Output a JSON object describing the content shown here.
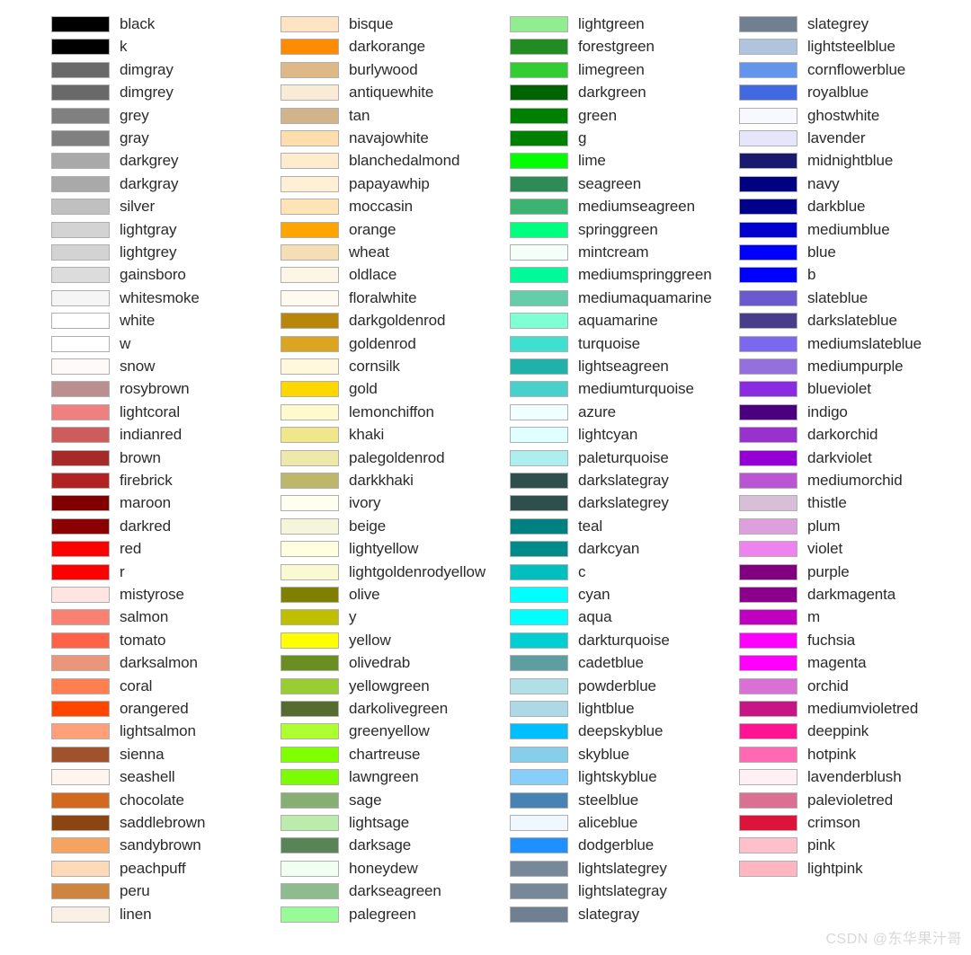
{
  "chart_data": {
    "type": "table",
    "title": "",
    "subtitle": "",
    "xlabel": "",
    "ylabel": "",
    "layout": {
      "columns": 4,
      "rows_per_column": 40,
      "swatch_border": "#b0b0b0",
      "background": "#ffffff",
      "text_color": "#2b2b2b"
    },
    "columns": [
      {
        "index": 0,
        "entries": [
          {
            "label": "black",
            "hex": "#000000"
          },
          {
            "label": "k",
            "hex": "#000000"
          },
          {
            "label": "dimgray",
            "hex": "#696969"
          },
          {
            "label": "dimgrey",
            "hex": "#696969"
          },
          {
            "label": "grey",
            "hex": "#808080"
          },
          {
            "label": "gray",
            "hex": "#808080"
          },
          {
            "label": "darkgrey",
            "hex": "#a9a9a9"
          },
          {
            "label": "darkgray",
            "hex": "#a9a9a9"
          },
          {
            "label": "silver",
            "hex": "#c0c0c0"
          },
          {
            "label": "lightgray",
            "hex": "#d3d3d3"
          },
          {
            "label": "lightgrey",
            "hex": "#d3d3d3"
          },
          {
            "label": "gainsboro",
            "hex": "#dcdcdc"
          },
          {
            "label": "whitesmoke",
            "hex": "#f5f5f5"
          },
          {
            "label": "white",
            "hex": "#ffffff"
          },
          {
            "label": "w",
            "hex": "#ffffff"
          },
          {
            "label": "snow",
            "hex": "#fffafa"
          },
          {
            "label": "rosybrown",
            "hex": "#bc8f8f"
          },
          {
            "label": "lightcoral",
            "hex": "#f08080"
          },
          {
            "label": "indianred",
            "hex": "#cd5c5c"
          },
          {
            "label": "brown",
            "hex": "#a52a2a"
          },
          {
            "label": "firebrick",
            "hex": "#b22222"
          },
          {
            "label": "maroon",
            "hex": "#800000"
          },
          {
            "label": "darkred",
            "hex": "#8b0000"
          },
          {
            "label": "red",
            "hex": "#ff0000"
          },
          {
            "label": "r",
            "hex": "#ff0000"
          },
          {
            "label": "mistyrose",
            "hex": "#ffe4e1"
          },
          {
            "label": "salmon",
            "hex": "#fa8072"
          },
          {
            "label": "tomato",
            "hex": "#ff6347"
          },
          {
            "label": "darksalmon",
            "hex": "#e9967a"
          },
          {
            "label": "coral",
            "hex": "#ff7f50"
          },
          {
            "label": "orangered",
            "hex": "#ff4500"
          },
          {
            "label": "lightsalmon",
            "hex": "#ffa07a"
          },
          {
            "label": "sienna",
            "hex": "#a0522d"
          },
          {
            "label": "seashell",
            "hex": "#fff5ee"
          },
          {
            "label": "chocolate",
            "hex": "#d2691e"
          },
          {
            "label": "saddlebrown",
            "hex": "#8b4513"
          },
          {
            "label": "sandybrown",
            "hex": "#f4a460"
          },
          {
            "label": "peachpuff",
            "hex": "#ffdab9"
          },
          {
            "label": "peru",
            "hex": "#cd853f"
          },
          {
            "label": "linen",
            "hex": "#faf0e6"
          }
        ]
      },
      {
        "index": 1,
        "entries": [
          {
            "label": "bisque",
            "hex": "#ffe4c4"
          },
          {
            "label": "darkorange",
            "hex": "#ff8c00"
          },
          {
            "label": "burlywood",
            "hex": "#deb887"
          },
          {
            "label": "antiquewhite",
            "hex": "#faebd7"
          },
          {
            "label": "tan",
            "hex": "#d2b48c"
          },
          {
            "label": "navajowhite",
            "hex": "#ffdead"
          },
          {
            "label": "blanchedalmond",
            "hex": "#ffebcd"
          },
          {
            "label": "papayawhip",
            "hex": "#ffefd5"
          },
          {
            "label": "moccasin",
            "hex": "#ffe4b5"
          },
          {
            "label": "orange",
            "hex": "#ffa500"
          },
          {
            "label": "wheat",
            "hex": "#f5deb3"
          },
          {
            "label": "oldlace",
            "hex": "#fdf5e6"
          },
          {
            "label": "floralwhite",
            "hex": "#fffaf0"
          },
          {
            "label": "darkgoldenrod",
            "hex": "#b8860b"
          },
          {
            "label": "goldenrod",
            "hex": "#daa520"
          },
          {
            "label": "cornsilk",
            "hex": "#fff8dc"
          },
          {
            "label": "gold",
            "hex": "#ffd700"
          },
          {
            "label": "lemonchiffon",
            "hex": "#fffacd"
          },
          {
            "label": "khaki",
            "hex": "#f0e68c"
          },
          {
            "label": "palegoldenrod",
            "hex": "#eee8aa"
          },
          {
            "label": "darkkhaki",
            "hex": "#bdb76b"
          },
          {
            "label": "ivory",
            "hex": "#fffff0"
          },
          {
            "label": "beige",
            "hex": "#f5f5dc"
          },
          {
            "label": "lightyellow",
            "hex": "#ffffe0"
          },
          {
            "label": "lightgoldenrodyellow",
            "hex": "#fafad2"
          },
          {
            "label": "olive",
            "hex": "#808000"
          },
          {
            "label": "y",
            "hex": "#bfbf00"
          },
          {
            "label": "yellow",
            "hex": "#ffff00"
          },
          {
            "label": "olivedrab",
            "hex": "#6b8e23"
          },
          {
            "label": "yellowgreen",
            "hex": "#9acd32"
          },
          {
            "label": "darkolivegreen",
            "hex": "#556b2f"
          },
          {
            "label": "greenyellow",
            "hex": "#adff2f"
          },
          {
            "label": "chartreuse",
            "hex": "#7fff00"
          },
          {
            "label": "lawngreen",
            "hex": "#7cfc00"
          },
          {
            "label": "sage",
            "hex": "#87ae73"
          },
          {
            "label": "lightsage",
            "hex": "#bcecac"
          },
          {
            "label": "darksage",
            "hex": "#598556"
          },
          {
            "label": "honeydew",
            "hex": "#f0fff0"
          },
          {
            "label": "darkseagreen",
            "hex": "#8fbc8f"
          },
          {
            "label": "palegreen",
            "hex": "#98fb98"
          }
        ]
      },
      {
        "index": 2,
        "entries": [
          {
            "label": "lightgreen",
            "hex": "#90ee90"
          },
          {
            "label": "forestgreen",
            "hex": "#228b22"
          },
          {
            "label": "limegreen",
            "hex": "#32cd32"
          },
          {
            "label": "darkgreen",
            "hex": "#006400"
          },
          {
            "label": "green",
            "hex": "#008000"
          },
          {
            "label": "g",
            "hex": "#008000"
          },
          {
            "label": "lime",
            "hex": "#00ff00"
          },
          {
            "label": "seagreen",
            "hex": "#2e8b57"
          },
          {
            "label": "mediumseagreen",
            "hex": "#3cb371"
          },
          {
            "label": "springgreen",
            "hex": "#00ff7f"
          },
          {
            "label": "mintcream",
            "hex": "#f5fffa"
          },
          {
            "label": "mediumspringgreen",
            "hex": "#00fa9a"
          },
          {
            "label": "mediumaquamarine",
            "hex": "#66cdaa"
          },
          {
            "label": "aquamarine",
            "hex": "#7fffd4"
          },
          {
            "label": "turquoise",
            "hex": "#40e0d0"
          },
          {
            "label": "lightseagreen",
            "hex": "#20b2aa"
          },
          {
            "label": "mediumturquoise",
            "hex": "#48d1cc"
          },
          {
            "label": "azure",
            "hex": "#f0ffff"
          },
          {
            "label": "lightcyan",
            "hex": "#e0ffff"
          },
          {
            "label": "paleturquoise",
            "hex": "#afeeee"
          },
          {
            "label": "darkslategray",
            "hex": "#2f4f4f"
          },
          {
            "label": "darkslategrey",
            "hex": "#2f4f4f"
          },
          {
            "label": "teal",
            "hex": "#008080"
          },
          {
            "label": "darkcyan",
            "hex": "#008b8b"
          },
          {
            "label": "c",
            "hex": "#00bfbf"
          },
          {
            "label": "cyan",
            "hex": "#00ffff"
          },
          {
            "label": "aqua",
            "hex": "#00ffff"
          },
          {
            "label": "darkturquoise",
            "hex": "#00ced1"
          },
          {
            "label": "cadetblue",
            "hex": "#5f9ea0"
          },
          {
            "label": "powderblue",
            "hex": "#b0e0e6"
          },
          {
            "label": "lightblue",
            "hex": "#add8e6"
          },
          {
            "label": "deepskyblue",
            "hex": "#00bfff"
          },
          {
            "label": "skyblue",
            "hex": "#87ceeb"
          },
          {
            "label": "lightskyblue",
            "hex": "#87cefa"
          },
          {
            "label": "steelblue",
            "hex": "#4682b4"
          },
          {
            "label": "aliceblue",
            "hex": "#f0f8ff"
          },
          {
            "label": "dodgerblue",
            "hex": "#1e90ff"
          },
          {
            "label": "lightslategrey",
            "hex": "#778899"
          },
          {
            "label": "lightslategray",
            "hex": "#778899"
          },
          {
            "label": "slategray",
            "hex": "#708090"
          }
        ]
      },
      {
        "index": 3,
        "entries": [
          {
            "label": "slategrey",
            "hex": "#708090"
          },
          {
            "label": "lightsteelblue",
            "hex": "#b0c4de"
          },
          {
            "label": "cornflowerblue",
            "hex": "#6495ed"
          },
          {
            "label": "royalblue",
            "hex": "#4169e1"
          },
          {
            "label": "ghostwhite",
            "hex": "#f8f8ff"
          },
          {
            "label": "lavender",
            "hex": "#e6e6fa"
          },
          {
            "label": "midnightblue",
            "hex": "#191970"
          },
          {
            "label": "navy",
            "hex": "#000080"
          },
          {
            "label": "darkblue",
            "hex": "#00008b"
          },
          {
            "label": "mediumblue",
            "hex": "#0000cd"
          },
          {
            "label": "blue",
            "hex": "#0000ff"
          },
          {
            "label": "b",
            "hex": "#0000ff"
          },
          {
            "label": "slateblue",
            "hex": "#6a5acd"
          },
          {
            "label": "darkslateblue",
            "hex": "#483d8b"
          },
          {
            "label": "mediumslateblue",
            "hex": "#7b68ee"
          },
          {
            "label": "mediumpurple",
            "hex": "#9370db"
          },
          {
            "label": "blueviolet",
            "hex": "#8a2be2"
          },
          {
            "label": "indigo",
            "hex": "#4b0082"
          },
          {
            "label": "darkorchid",
            "hex": "#9932cc"
          },
          {
            "label": "darkviolet",
            "hex": "#9400d3"
          },
          {
            "label": "mediumorchid",
            "hex": "#ba55d3"
          },
          {
            "label": "thistle",
            "hex": "#d8bfd8"
          },
          {
            "label": "plum",
            "hex": "#dda0dd"
          },
          {
            "label": "violet",
            "hex": "#ee82ee"
          },
          {
            "label": "purple",
            "hex": "#800080"
          },
          {
            "label": "darkmagenta",
            "hex": "#8b008b"
          },
          {
            "label": "m",
            "hex": "#bf00bf"
          },
          {
            "label": "fuchsia",
            "hex": "#ff00ff"
          },
          {
            "label": "magenta",
            "hex": "#ff00ff"
          },
          {
            "label": "orchid",
            "hex": "#da70d6"
          },
          {
            "label": "mediumvioletred",
            "hex": "#c71585"
          },
          {
            "label": "deeppink",
            "hex": "#ff1493"
          },
          {
            "label": "hotpink",
            "hex": "#ff69b4"
          },
          {
            "label": "lavenderblush",
            "hex": "#fff0f5"
          },
          {
            "label": "palevioletred",
            "hex": "#db7093"
          },
          {
            "label": "crimson",
            "hex": "#dc143c"
          },
          {
            "label": "pink",
            "hex": "#ffc0cb"
          },
          {
            "label": "lightpink",
            "hex": "#ffb6c1"
          }
        ]
      }
    ]
  },
  "watermark": {
    "text": "CSDN @东华果汁哥"
  }
}
